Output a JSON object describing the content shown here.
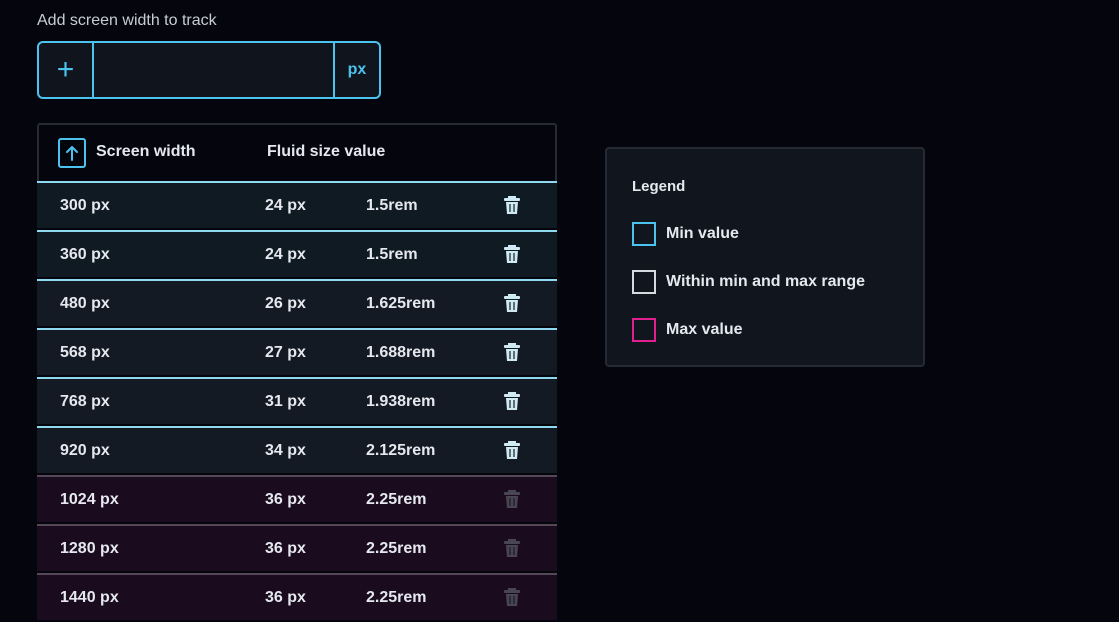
{
  "add": {
    "label": "Add screen width to track",
    "add_symbol": "+",
    "value": "",
    "unit": "px"
  },
  "table": {
    "sort_icon": "arrow-up-icon",
    "headers": [
      "Screen width",
      "Fluid size value"
    ],
    "rows": [
      {
        "width": "300 px",
        "px": "24 px",
        "rem": "1.5rem",
        "kind": "min"
      },
      {
        "width": "360 px",
        "px": "24 px",
        "rem": "1.5rem",
        "kind": "min"
      },
      {
        "width": "480 px",
        "px": "26 px",
        "rem": "1.625rem",
        "kind": "mid"
      },
      {
        "width": "568 px",
        "px": "27 px",
        "rem": "1.688rem",
        "kind": "mid"
      },
      {
        "width": "768 px",
        "px": "31 px",
        "rem": "1.938rem",
        "kind": "mid"
      },
      {
        "width": "920 px",
        "px": "34 px",
        "rem": "2.125rem",
        "kind": "mid"
      },
      {
        "width": "1024 px",
        "px": "36 px",
        "rem": "2.25rem",
        "kind": "max"
      },
      {
        "width": "1280 px",
        "px": "36 px",
        "rem": "2.25rem",
        "kind": "max"
      },
      {
        "width": "1440 px",
        "px": "36 px",
        "rem": "2.25rem",
        "kind": "max"
      }
    ]
  },
  "legend": {
    "title": "Legend",
    "items": [
      {
        "label": "Min value",
        "color": "#4cc3ee"
      },
      {
        "label": "Within min and max range",
        "color": "#d7d9e0"
      },
      {
        "label": "Max value",
        "color": "#e0208f"
      }
    ]
  },
  "colors": {
    "accent": "#4cc3ee",
    "trash_active": "#cfeaf5",
    "trash_inactive": "#4a4552"
  }
}
